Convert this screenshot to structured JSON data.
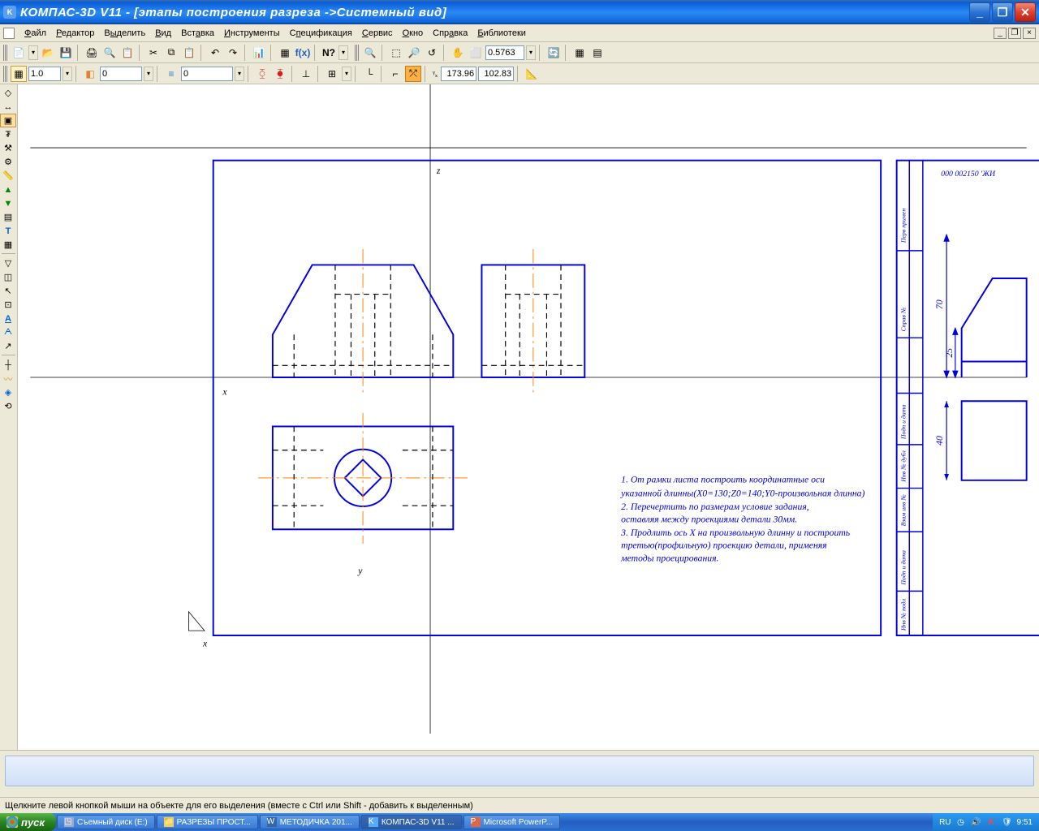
{
  "title": "КОМПАС-3D V11 - [этапы построения разреза ->Системный вид]",
  "menu": {
    "file": "Файл",
    "edit": "Редактор",
    "select": "Выделить",
    "view": "Вид",
    "insert": "Вставка",
    "tools": "Инструменты",
    "spec": "Спецификация",
    "service": "Сервис",
    "window": "Окно",
    "help": "Справка",
    "libs": "Библиотеки"
  },
  "toolbar1": {
    "zoom_value": "0.5763"
  },
  "toolbar2": {
    "scale": "1.0",
    "layer": "0",
    "style": "0",
    "coord_x": "173.96",
    "coord_y": "102.83"
  },
  "drawing": {
    "axis_z": "z",
    "axis_x": "x",
    "axis_y": "y",
    "axis_x2": "x",
    "dim_70": "70",
    "dim_25": "25",
    "dim_40": "40",
    "frame_text": "000 002150 'ЖИ",
    "notes": {
      "l1": "1. От рамки листа построить координатные оси",
      "l2": "указанной длинны(X0=130;Z0=140;Y0-произвольная длинна)",
      "l3": "2. Перечертить по размерам условие задания,",
      "l4": "оставляя между проекциями детали 30мм.",
      "l5": "3. Продлить ось X на произвольную длинну и построить",
      "l6": "третью(профильную) проекцию детали, применяя",
      "l7": "методы проецирования."
    },
    "stamp": {
      "r1": "Перв примен",
      "r2": "Справ №",
      "r3": "Подп и дата",
      "r4": "Инв № дубл",
      "r5": "Взам инв №",
      "r6": "Подп и дата",
      "r7": "Инв № подл"
    }
  },
  "status": "Щелкните левой кнопкой мыши на объекте для его выделения (вместе с Ctrl или Shift - добавить к выделенным)",
  "taskbar": {
    "start": "пуск",
    "items": [
      "Съемный диск (E:)",
      "РАЗРЕЗЫ ПРОСТ...",
      "МЕТОДИЧКА 201...",
      "КОМПАС-3D V11 ...",
      "Microsoft PowerP..."
    ],
    "lang": "RU",
    "clock": "9:51"
  }
}
